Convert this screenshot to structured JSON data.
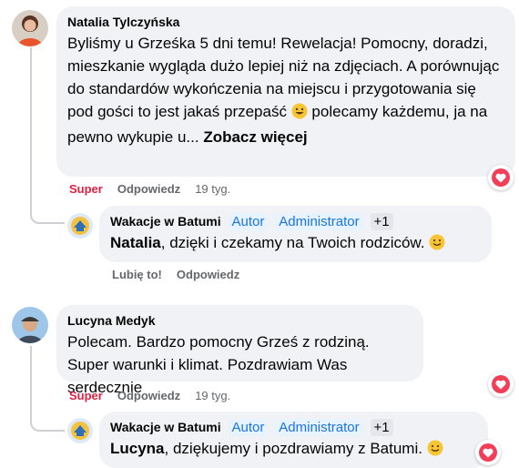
{
  "comments": [
    {
      "author": "Natalia Tylczyńska",
      "text": "Byliśmy u Grześka 5 dni temu! Rewelacja! Pomocny, doradzi, mieszkanie wygląda dużo lepiej niż na zdjęciach. A porównując do standardów wykończenia na miejscu i przygotowania się pod gości to jest jakaś przepaść",
      "text_after_emoji": " polecamy każdemu, ja na pewno wykupie u...",
      "see_more": "Zobacz więcej",
      "reaction_label": "Super",
      "reply_label": "Odpowiedz",
      "time": "19 tyg.",
      "reaction_icon": "heart-icon",
      "reply": {
        "author": "Wakacje w Batumi",
        "badges": [
          "Autor",
          "Administrator",
          "+1"
        ],
        "mention": "Natalia",
        "text": ", dzięki i czekamy na Twoich rodziców.",
        "like_label": "Lubię to!",
        "reply_label": "Odpowiedz"
      }
    },
    {
      "author": "Lucyna Medyk",
      "text": "Polecam. Bardzo pomocny Grześ z rodziną. Super warunki i klimat. Pozdrawiam Was serdecznie",
      "reaction_label": "Super",
      "reply_label": "Odpowiedz",
      "time": "19 tyg.",
      "reaction_icon": "heart-icon",
      "reply": {
        "author": "Wakacje w Batumi",
        "badges": [
          "Autor",
          "Administrator",
          "+1"
        ],
        "mention": "Lucyna",
        "text": ", dziękujemy i pozdrawiamy z Batumi.",
        "reaction_icon": "heart-icon"
      }
    }
  ],
  "colors": {
    "super": "#e41e3f",
    "badge_bg": "#e7f3ff",
    "badge_text": "#1b74e4",
    "bubble": "#f0f2f5",
    "heart": "#f33e58"
  }
}
